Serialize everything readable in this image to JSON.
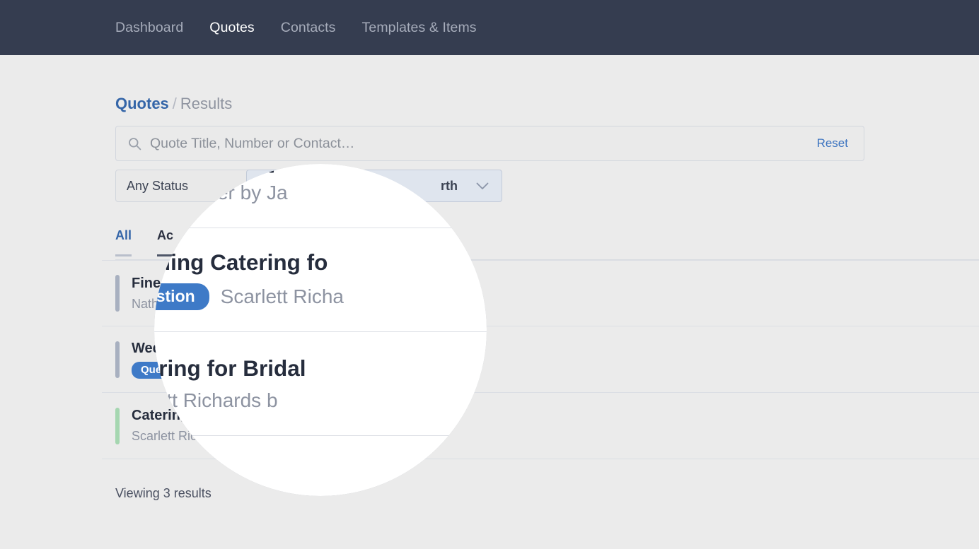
{
  "nav": {
    "items": [
      {
        "label": "Dashboard",
        "active": false
      },
      {
        "label": "Quotes",
        "active": true
      },
      {
        "label": "Contacts",
        "active": false
      },
      {
        "label": "Templates & Items",
        "active": false
      }
    ]
  },
  "breadcrumb": {
    "root": "Quotes",
    "separator": "/",
    "current": "Results"
  },
  "search": {
    "placeholder": "Quote Title, Number or Contact…",
    "value": "",
    "reset_label": "Reset",
    "icon": "search-icon"
  },
  "filters": {
    "status": {
      "label": "Any Status",
      "icon": "chevron-down-icon"
    },
    "sort": {
      "label": "rth",
      "icon": "chevron-down-icon"
    }
  },
  "tabs": [
    {
      "label": "All",
      "active": true
    },
    {
      "label": "Ac",
      "active": false
    }
  ],
  "results": {
    "rows": [
      {
        "title": "Fine Catering Q",
        "subtitle": "Nathan Carter by Ja",
        "badge": "",
        "bar_color": "#a8b0c0"
      },
      {
        "title": "Wedding Catering fo",
        "subtitle": "Scarlett Richa",
        "badge": "Question",
        "bar_color": "#a8b0c0"
      },
      {
        "title": "Catering for Bridal",
        "subtitle": "Scarlett Richards b",
        "badge": "",
        "bar_color": "#a5d6b0"
      }
    ],
    "count_label": "Viewing 3 results"
  },
  "colors": {
    "header_bg": "#353d50",
    "page_bg": "#ebebeb",
    "accent_blue": "#3465a8",
    "badge_blue": "#3e7ac7",
    "bar_gray": "#a8b0c0",
    "bar_green": "#a5d6b0"
  }
}
